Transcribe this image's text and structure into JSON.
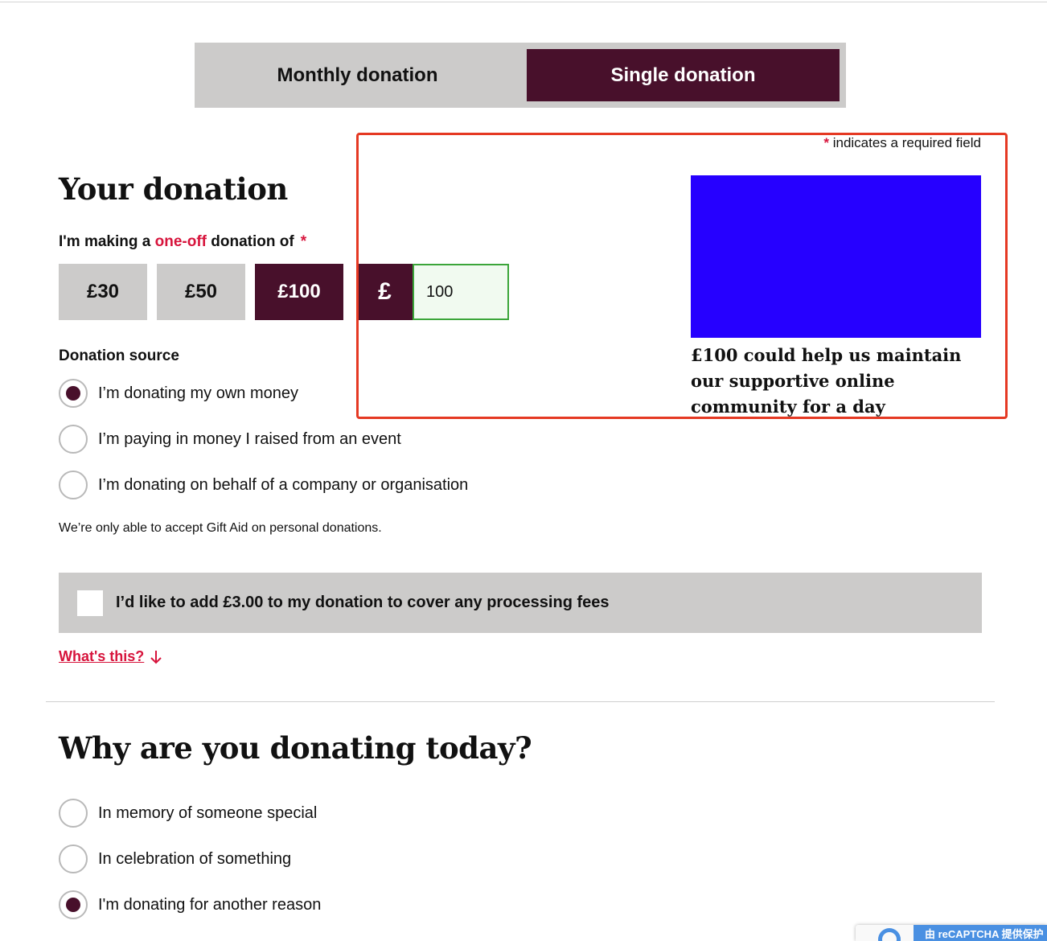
{
  "tabs": {
    "monthly_label": "Monthly donation",
    "single_label": "Single donation",
    "active": "single"
  },
  "required_note": {
    "asterisk": "*",
    "text": "indicates a required field"
  },
  "donation": {
    "title": "Your donation",
    "making_prefix": "I'm making a ",
    "making_highlight": "one-off",
    "making_suffix": " donation of",
    "asterisk": "*",
    "amounts": [
      "£30",
      "£50",
      "£100"
    ],
    "selected_amount": "£100",
    "currency_symbol": "£",
    "custom_amount_value": "100",
    "impact_text": "£100 could help us maintain our supportive online community for a day",
    "source_label": "Donation source",
    "source_options": [
      {
        "label": "I’m donating my own money",
        "checked": true
      },
      {
        "label": "I’m paying in money I raised from an event",
        "checked": false
      },
      {
        "label": "I’m donating on behalf of a company or organisation",
        "checked": false
      }
    ],
    "gift_aid_note": "We’re only able to accept Gift Aid on personal donations.",
    "fees_label": "I’d like to add £3.00 to my donation to cover any processing fees",
    "whats_this": "What's this?"
  },
  "why": {
    "title": "Why are you donating today?",
    "options": [
      {
        "label": "In memory of someone special",
        "checked": false
      },
      {
        "label": "In celebration of something",
        "checked": false
      },
      {
        "label": "I'm donating for another reason",
        "checked": true
      }
    ]
  },
  "recaptcha": {
    "text": "由 reCAPTCHA 提供保护"
  },
  "colors": {
    "brand_dark": "#48102b",
    "accent_red": "#d7143c",
    "highlight_box": "#e53923",
    "impact_image": "#2600ff",
    "input_border": "#3ca53a"
  }
}
